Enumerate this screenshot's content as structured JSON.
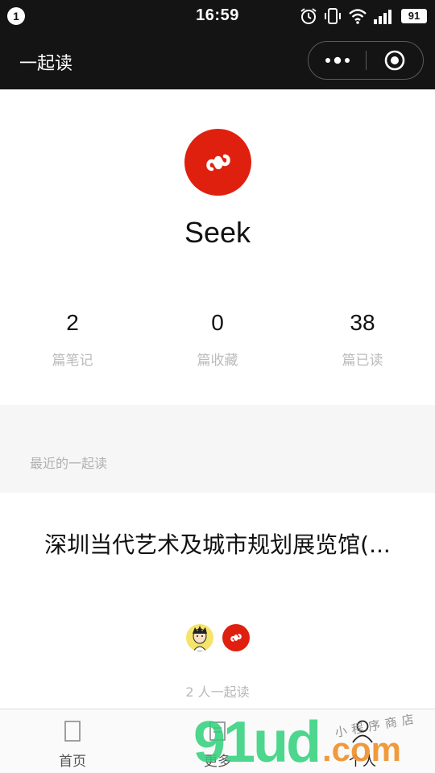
{
  "status_bar": {
    "notification_count": "1",
    "time": "16:59",
    "battery": "91",
    "icons": [
      "alarm-icon",
      "vibrate-icon",
      "wifi-icon",
      "signal-icon",
      "battery-icon"
    ]
  },
  "nav": {
    "title": "一起读",
    "more_icon": "more-dots-icon",
    "close_icon": "target-close-icon"
  },
  "profile": {
    "avatar_icon": "mini-program-logo-icon",
    "avatar_color": "#e0200f",
    "username": "Seek"
  },
  "stats": [
    {
      "value": "2",
      "label": "篇笔记"
    },
    {
      "value": "0",
      "label": "篇收藏"
    },
    {
      "value": "38",
      "label": "篇已读"
    }
  ],
  "recent": {
    "section_title": "最近的一起读",
    "items": [
      {
        "title": "深圳当代艺术及城市规划展览馆(...",
        "readers_count": "2 人一起读"
      }
    ]
  },
  "tab_bar": {
    "tabs": [
      {
        "label": "首页",
        "icon": "home-icon",
        "active": false
      },
      {
        "label": "更多",
        "icon": "more-icon",
        "active": false
      },
      {
        "label": "个人",
        "icon": "person-icon",
        "active": true
      }
    ]
  },
  "watermark": {
    "brand": "91ud",
    "suffix": ".com",
    "tagline": "小程序商店"
  }
}
